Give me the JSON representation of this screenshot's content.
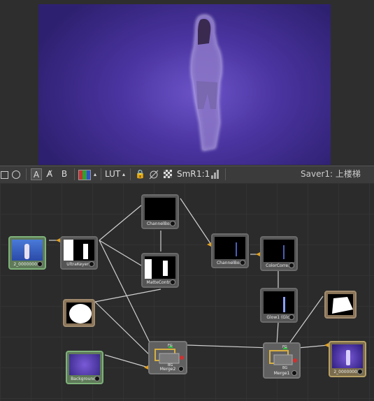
{
  "toolbar": {
    "buttons": [
      "A",
      "A̸",
      "B"
    ],
    "lut_label": "LUT",
    "smr_label": "SmR",
    "ratio_label": "1:1",
    "saver_status": "Saver1: 上楼梯"
  },
  "nodes": {
    "loader": "2_0000000...",
    "ultrakeyer": "UltraKeyer1",
    "channelbool1": "ChannelBo...",
    "mattecontrol": "MatteContr...",
    "channelbool2": "ChannelBo...",
    "colorcorrector": "ColorCorre...",
    "glow": "Glow1 (Glo)",
    "background": "Background1",
    "merge2": "Merge2",
    "merge1": "Merge1",
    "saver": "2_0000000..."
  },
  "merge_ports": {
    "fg": "FG",
    "bg": "BG"
  },
  "colors": {
    "accent_green": "#7fb27a",
    "saver_tan": "#b8a066",
    "viewer_purple": "#4a34a0"
  }
}
